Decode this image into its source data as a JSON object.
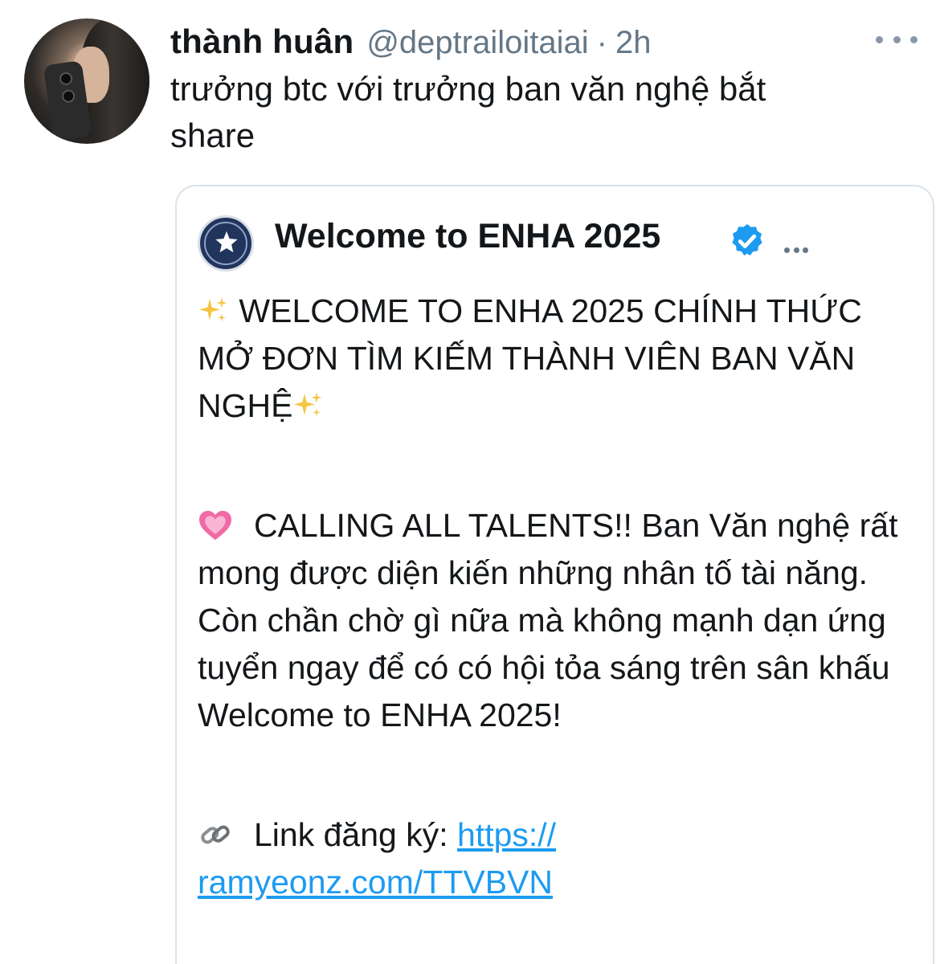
{
  "tweet": {
    "author_name": "thành huân",
    "author_handle": "@deptrailoitaiai",
    "separator": "·",
    "time": "2h",
    "text": "trưởng btc với trưởng ban văn nghệ bắt\nshare"
  },
  "quoted_tweet": {
    "author_name": "Welcome to ENHA 2025",
    "verified": true,
    "line1_text": "WELCOME TO ENHA 2025 CHÍNH THỨC MỞ ĐƠN TÌM KIẾM THÀNH VIÊN BAN VĂN NGHỆ",
    "para2_text": "CALLING ALL TALENTS!! Ban Văn nghệ rất mong được diện kiến những nhân tố tài năng. Còn chần chờ gì nữa mà không mạnh dạn ứng tuyển ngay để có có hội tỏa sáng trên sân khấu Welcome to ENHA 2025!",
    "link_label": "Link đăng ký:",
    "link_url": "https://ramyeonz.com/TTVBVN",
    "link_part1": "https://",
    "link_part2": "ramyeonz.com/TTVBVN"
  },
  "icons": [
    "more-horizontal-icon",
    "verified-badge-icon",
    "sparkles-icon",
    "heart-icon",
    "link-icon"
  ],
  "colors": {
    "link": "#1d9bf0",
    "verified": "#1d9bf0",
    "secondary_text": "#657786",
    "quote_border": "#dbe3ea"
  }
}
